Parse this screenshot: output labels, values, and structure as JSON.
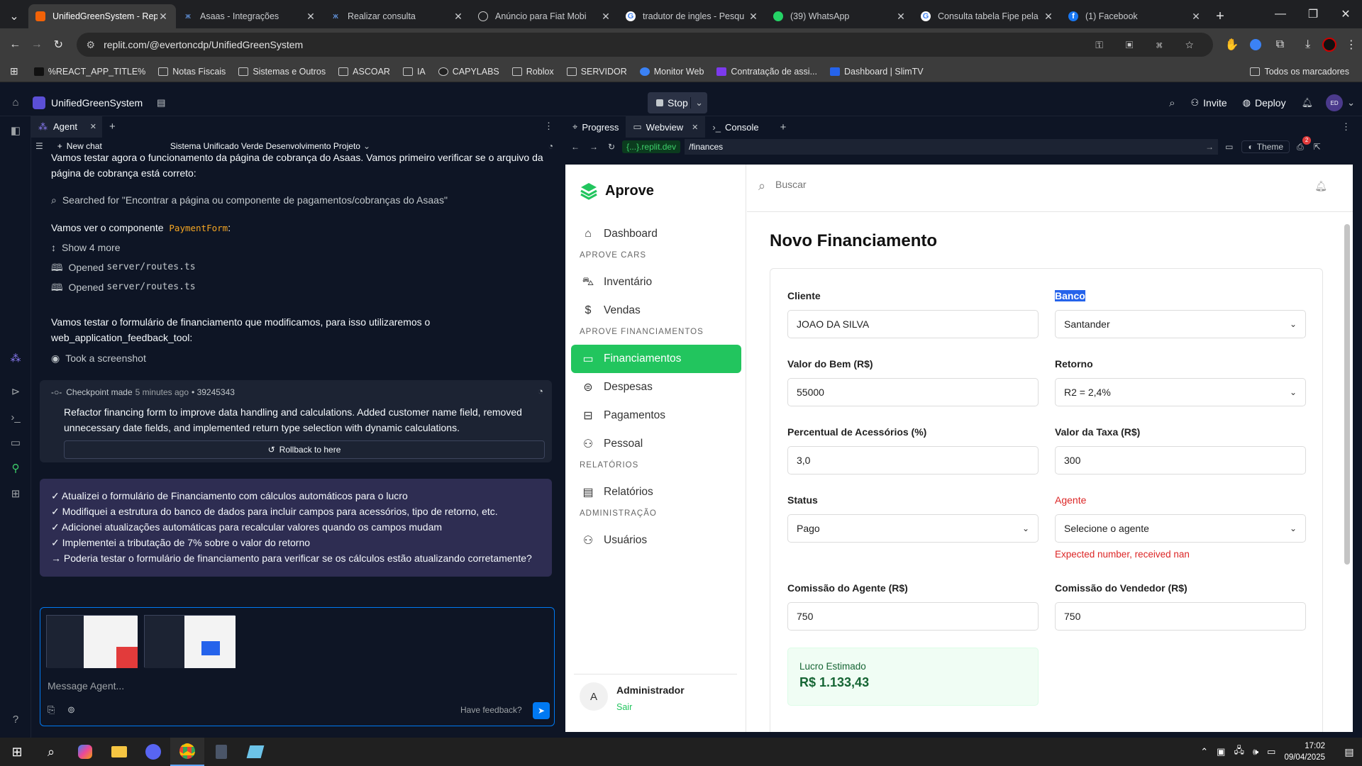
{
  "browser": {
    "tabs": [
      {
        "title": "UnifiedGreenSystem - Rep",
        "active": true,
        "icon": "replit-icon"
      },
      {
        "title": "Asaas - Integrações",
        "active": false,
        "icon": "asaas-icon"
      },
      {
        "title": "Realizar consulta",
        "active": false,
        "icon": "asaas-icon"
      },
      {
        "title": "Anúncio para Fiat Mobi",
        "active": false,
        "icon": "globe-icon"
      },
      {
        "title": "tradutor de ingles - Pesqu",
        "active": false,
        "icon": "google-icon"
      },
      {
        "title": "(39) WhatsApp",
        "active": false,
        "icon": "whatsapp-icon"
      },
      {
        "title": "Consulta tabela Fipe pela",
        "active": false,
        "icon": "google-icon"
      },
      {
        "title": "(1) Facebook",
        "active": false,
        "icon": "facebook-icon"
      }
    ],
    "url": "replit.com/@evertoncdp/UnifiedGreenSystem",
    "bookmarks": [
      "%REACT_APP_TITLE%",
      "Notas Fiscais",
      "Sistemas e Outros",
      "ASCOAR",
      "IA",
      "CAPYLABS",
      "Roblox",
      "SERVIDOR",
      "Monitor Web",
      "Contratação de assi...",
      "Dashboard | SlimTV"
    ],
    "all_bookmarks": "Todos os marcadores"
  },
  "replit": {
    "project_name": "UnifiedGreenSystem",
    "stop_label": "Stop",
    "invite_label": "Invite",
    "deploy_label": "Deploy",
    "avatar_initials": "ED"
  },
  "agent": {
    "tab_label": "Agent",
    "new_chat": "New chat",
    "chat_title": "Sistema Unificado Verde Desenvolvimento Projeto",
    "messages": {
      "intro_line1": "Vamos testar agora o funcionamento da página de cobrança do Asaas. Vamos primeiro verificar se o arquivo da",
      "intro_line2": "página de cobrança está correto:",
      "search": "Searched for \"Encontrar a página ou componente de pagamentos/cobranças do Asaas\"",
      "component_prefix": "Vamos ver o componente",
      "component_name": "PaymentForm",
      "component_suffix": ":",
      "show_more": "Show 4 more",
      "opened_prefix": "Opened",
      "opened_file": "server/routes.ts",
      "test_line1": "Vamos testar o formulário de financiamento que modificamos, para isso utilizaremos o",
      "test_line2": "web_application_feedback_tool:",
      "screenshot": "Took a screenshot"
    },
    "checkpoint": {
      "prefix": "Checkpoint made",
      "time": "5 minutes ago",
      "hash": "• 39245343",
      "desc_line1": "Refactor financing form to improve data handling and calculations. Added customer name field, removed",
      "desc_line2": "unnecessary date fields, and implemented return type selection with dynamic calculations.",
      "rollback": "Rollback to here"
    },
    "summary": [
      "✓ Atualizei o formulário de Financiamento com cálculos automáticos para o lucro",
      "✓ Modifiquei a estrutura do banco de dados para incluir campos para acessórios, tipo de retorno, etc.",
      "✓ Adicionei atualizações automáticas para recalcular valores quando os campos mudam",
      "✓ Implementei a tributação de 7% sobre o valor do retorno",
      "→ Poderia testar o formulário de financiamento para verificar se os cálculos estão atualizando corretamente?"
    ],
    "input_placeholder": "Message Agent...",
    "feedback": "Have feedback?"
  },
  "webview": {
    "tabs": [
      "Progress",
      "Webview",
      "Console"
    ],
    "domain": "{...}.replit.dev",
    "path": "/finances",
    "theme_label": "Theme",
    "notif_count": "2"
  },
  "app": {
    "brand": "Aprove",
    "search_placeholder": "Buscar",
    "nav": {
      "dashboard": "Dashboard",
      "sec_cars": "APROVE CARS",
      "inventario": "Inventário",
      "vendas": "Vendas",
      "sec_fin": "APROVE FINANCIAMENTOS",
      "financiamentos": "Financiamentos",
      "despesas": "Despesas",
      "pagamentos": "Pagamentos",
      "pessoal": "Pessoal",
      "sec_rel": "RELATÓRIOS",
      "relatorios": "Relatórios",
      "sec_admin": "ADMINISTRAÇÃO",
      "usuarios": "Usuários"
    },
    "user": {
      "initial": "A",
      "name": "Administrador",
      "logout": "Sair"
    },
    "page_title": "Novo Financiamento",
    "form": {
      "cliente_label": "Cliente",
      "cliente_value": "JOAO DA SILVA",
      "banco_label": "Banco",
      "banco_value": "Santander",
      "valor_label": "Valor do Bem (R$)",
      "valor_value": "55000",
      "retorno_label": "Retorno",
      "retorno_value": "R2 = 2,4%",
      "acess_label": "Percentual de Acessórios (%)",
      "acess_value": "3,0",
      "taxa_label": "Valor da Taxa (R$)",
      "taxa_value": "300",
      "status_label": "Status",
      "status_value": "Pago",
      "agente_label": "Agente",
      "agente_value": "Selecione o agente",
      "agente_error": "Expected number, received nan",
      "com_agente_label": "Comissão do Agente (R$)",
      "com_agente_value": "750",
      "com_vend_label": "Comissão do Vendedor (R$)",
      "com_vend_value": "750",
      "lucro_label": "Lucro Estimado",
      "lucro_value": "R$ 1.133,43"
    },
    "colors": {
      "brand_green": "#22c55e",
      "error_red": "#dc2626"
    }
  },
  "taskbar": {
    "time": "17:02",
    "date": "09/04/2025"
  }
}
